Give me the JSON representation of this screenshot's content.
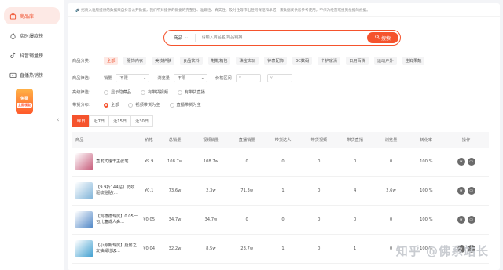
{
  "sidebar": {
    "items": [
      {
        "label": "商品库",
        "icon": "bag-icon",
        "active": true
      },
      {
        "label": "实时爆款榜",
        "icon": "fire-icon",
        "active": false
      },
      {
        "label": "抖音销量榜",
        "icon": "tiktok-icon",
        "active": false
      },
      {
        "label": "直播热销榜",
        "icon": "live-icon",
        "active": false
      }
    ],
    "promo_title": "免费",
    "promo_tag": "立即领取"
  },
  "notice": "🔊 招商入驻版提供的数据来自抖音公开数据，我们不对提供的数据的完整性、准确性、真实性、及时性等作出任何保证和承诺，该数据仅供您参考使用，不作为经营或投资依据的依据。",
  "search": {
    "type_label": "商品",
    "placeholder": "请输入商品名/商品链接",
    "button_label": "搜索"
  },
  "filters": {
    "category_label": "商品分类：",
    "categories": [
      "全部",
      "服饰内衣",
      "美妆护肤",
      "食品饮料",
      "鞋靴箱包",
      "珠宝文玩",
      "钟表配饰",
      "3C数码",
      "个护家清",
      "日用百货",
      "运动户外",
      "生鲜果蔬"
    ],
    "filter_label": "商品筛选：",
    "sales_label": "销量",
    "sales_value": "不限",
    "views_label": "浏览量",
    "views_value": "不限",
    "price_label": "价格区间",
    "price_min": "¥",
    "price_max": "¥",
    "advanced_label": "高级筛选：",
    "advanced_options": [
      "显示隐藏品",
      "有带货视频",
      "有带货直播"
    ],
    "dist_label": "带货分布：",
    "dist_options": [
      "全部",
      "视频带货为主",
      "直播带货为主"
    ]
  },
  "date_tabs": [
    "昨日",
    "近7日",
    "近15日",
    "近30日"
  ],
  "table": {
    "headers": [
      "商品",
      "价格",
      "总销量",
      "视频销量",
      "直播销量",
      "带货达人",
      "带货视频",
      "带货直播",
      "浏览量",
      "转化率",
      "操作"
    ],
    "rows": [
      {
        "name": "直发式速干主张笔",
        "price": "¥9.9",
        "total": "108.7w",
        "video": "108.7w",
        "live": "0",
        "creators": "0",
        "videos": "0",
        "lives": "0",
        "views": "0",
        "conv": "100 %",
        "thumb": "#c65b7a"
      },
      {
        "name": "【9.9折144贴】防蚊驱蚊贴贴(...",
        "price": "¥0.1",
        "total": "73.6w",
        "video": "2.3w",
        "live": "71.3w",
        "creators": "1",
        "videos": "0",
        "lives": "4",
        "views": "2.6w",
        "conv": "100 %",
        "thumb": "#7fb3d8"
      },
      {
        "name": "【刘德德专属】0.05一包儿童成人鼻...",
        "price": "¥0.05",
        "total": "34.7w",
        "video": "34.7w",
        "live": "0",
        "creators": "0",
        "videos": "0",
        "lives": "0",
        "views": "0",
        "conv": "100 %",
        "thumb": "#4f86c6"
      },
      {
        "name": "【小源新专属】厨房之友抽绳垃圾...",
        "price": "¥0.04",
        "total": "32.2w",
        "video": "8.5w",
        "live": "23.7w",
        "creators": "1",
        "videos": "0",
        "lives": "1",
        "views": "0",
        "conv": "100 %",
        "thumb": "#3f9fd0"
      }
    ]
  },
  "watermark": "知乎 @佛系站长"
}
